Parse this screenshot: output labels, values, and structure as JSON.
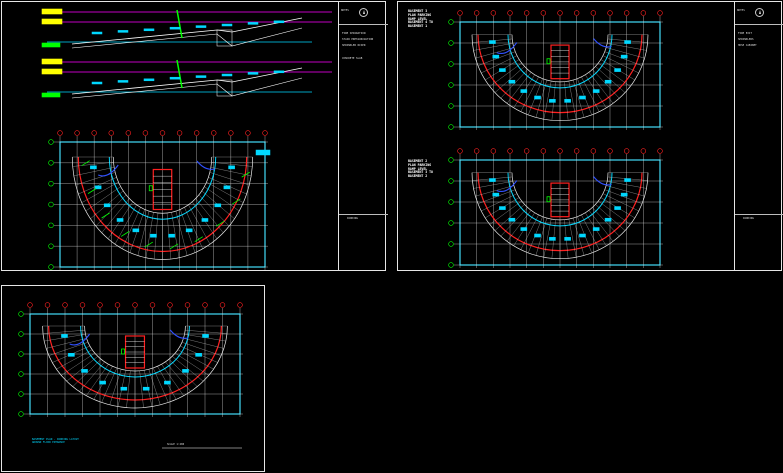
{
  "sheets": [
    {
      "id": "sheet-1",
      "titleblock": {
        "header": "NOTES",
        "notes": [
          "FIRE SEPARATION",
          "STAIR PRESSURIZATION",
          "SPRINKLER RISER",
          "CONCRETE SLAB"
        ],
        "footer": "PARKING"
      }
    },
    {
      "id": "sheet-2",
      "titleblock": {
        "header": "NOTES",
        "notes": [
          "FIRE EXIT",
          "SPRINKLERS",
          "HOSE CABINET"
        ],
        "footer": "PARKING"
      },
      "plan_labels": [
        "BASEMENT 3\nPLAN PARKING\nRAMP LEVEL\nBASEMENT 4 TO\nBASEMENT 1",
        "BASEMENT 2\nPLAN PARKING\nRAMP LEVEL\nBASEMENT 3 TO\nBASEMENT 2"
      ]
    },
    {
      "id": "sheet-3",
      "caption": "BASEMENT PLAN - PARKING LAYOUT\nGROUND FLOOR ENTRANCE",
      "scale": "SCALE 1:200"
    }
  ],
  "colors": {
    "bg": "#000000",
    "grid": "#e8e8e8",
    "wall": "#ff2020",
    "cyan": "#00d8ff",
    "green": "#00ff00",
    "magenta": "#ff00ff",
    "blue": "#3050ff",
    "yellow": "#ffff00"
  }
}
